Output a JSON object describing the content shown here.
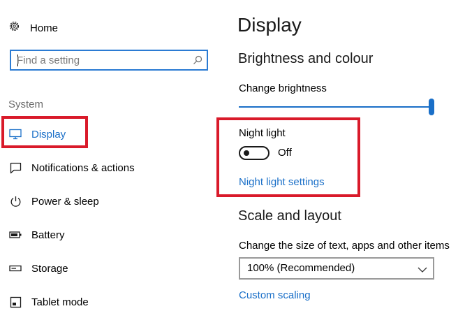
{
  "sidebar": {
    "home_label": "Home",
    "search": {
      "placeholder": "Find a setting",
      "value": ""
    },
    "section_label": "System",
    "items": [
      {
        "label": "Display",
        "icon": "monitor-icon",
        "selected": true
      },
      {
        "label": "Notifications & actions",
        "icon": "notification-icon"
      },
      {
        "label": "Power & sleep",
        "icon": "power-icon"
      },
      {
        "label": "Battery",
        "icon": "battery-icon"
      },
      {
        "label": "Storage",
        "icon": "storage-icon"
      },
      {
        "label": "Tablet mode",
        "icon": "tablet-mode-icon"
      }
    ]
  },
  "main": {
    "title": "Display",
    "brightness_section": {
      "heading": "Brightness and colour",
      "slider_label": "Change brightness",
      "brightness_fraction": 1.0,
      "night_light": {
        "label": "Night light",
        "state": "Off",
        "settings_link": "Night light settings"
      }
    },
    "scale_section": {
      "heading": "Scale and layout",
      "size_label": "Change the size of text, apps and other items",
      "size_value": "100% (Recommended)",
      "custom_link": "Custom scaling"
    }
  },
  "colors": {
    "accent": "#1a6fc8",
    "highlight_box": "#d91a2a",
    "search_border": "#2b7bd3"
  }
}
